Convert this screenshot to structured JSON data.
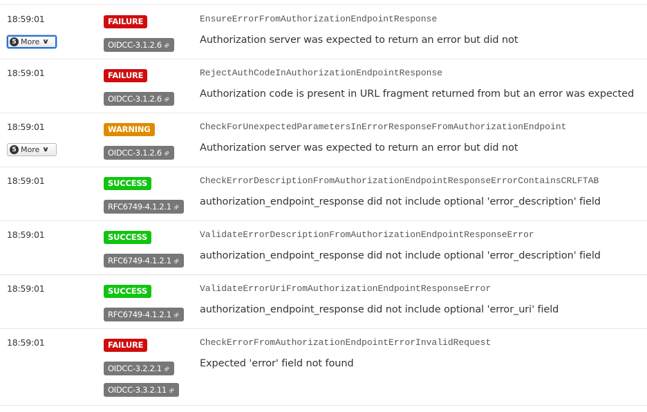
{
  "rows": [
    {
      "time": "18:59:01",
      "more": {
        "count": "5",
        "label": "More",
        "focused": true
      },
      "status": "FAILURE",
      "refs": [
        "OIDCC-3.1.2.6"
      ],
      "condition": "EnsureErrorFromAuthorizationEndpointResponse",
      "message": "Authorization server was expected to return an error but did not"
    },
    {
      "time": "18:59:01",
      "more": null,
      "status": "FAILURE",
      "refs": [
        "OIDCC-3.1.2.6"
      ],
      "condition": "RejectAuthCodeInAuthorizationEndpointResponse",
      "message": "Authorization code is present in URL fragment returned from but an error was expected"
    },
    {
      "time": "18:59:01",
      "more": {
        "count": "5",
        "label": "More",
        "focused": false
      },
      "status": "WARNING",
      "refs": [
        "OIDCC-3.1.2.6"
      ],
      "condition": "CheckForUnexpectedParametersInErrorResponseFromAuthorizationEndpoint",
      "message": "Authorization server was expected to return an error but did not"
    },
    {
      "time": "18:59:01",
      "more": null,
      "status": "SUCCESS",
      "refs": [
        "RFC6749-4.1.2.1"
      ],
      "condition": "CheckErrorDescriptionFromAuthorizationEndpointResponseErrorContainsCRLFTAB",
      "message": "authorization_endpoint_response did not include optional 'error_description' field"
    },
    {
      "time": "18:59:01",
      "more": null,
      "status": "SUCCESS",
      "refs": [
        "RFC6749-4.1.2.1"
      ],
      "condition": "ValidateErrorDescriptionFromAuthorizationEndpointResponseError",
      "message": "authorization_endpoint_response did not include optional 'error_description' field"
    },
    {
      "time": "18:59:01",
      "more": null,
      "status": "SUCCESS",
      "refs": [
        "RFC6749-4.1.2.1"
      ],
      "condition": "ValidateErrorUriFromAuthorizationEndpointResponseError",
      "message": "authorization_endpoint_response did not include optional 'error_uri' field"
    },
    {
      "time": "18:59:01",
      "more": null,
      "status": "FAILURE",
      "refs": [
        "OIDCC-3.2.2.1",
        "OIDCC-3.3.2.11"
      ],
      "condition": "CheckErrorFromAuthorizationEndpointErrorInvalidRequest",
      "message": "Expected 'error' field not found"
    }
  ],
  "icons": {
    "more_chevron": "chevron-down-icon",
    "ref_link": "link-icon"
  }
}
